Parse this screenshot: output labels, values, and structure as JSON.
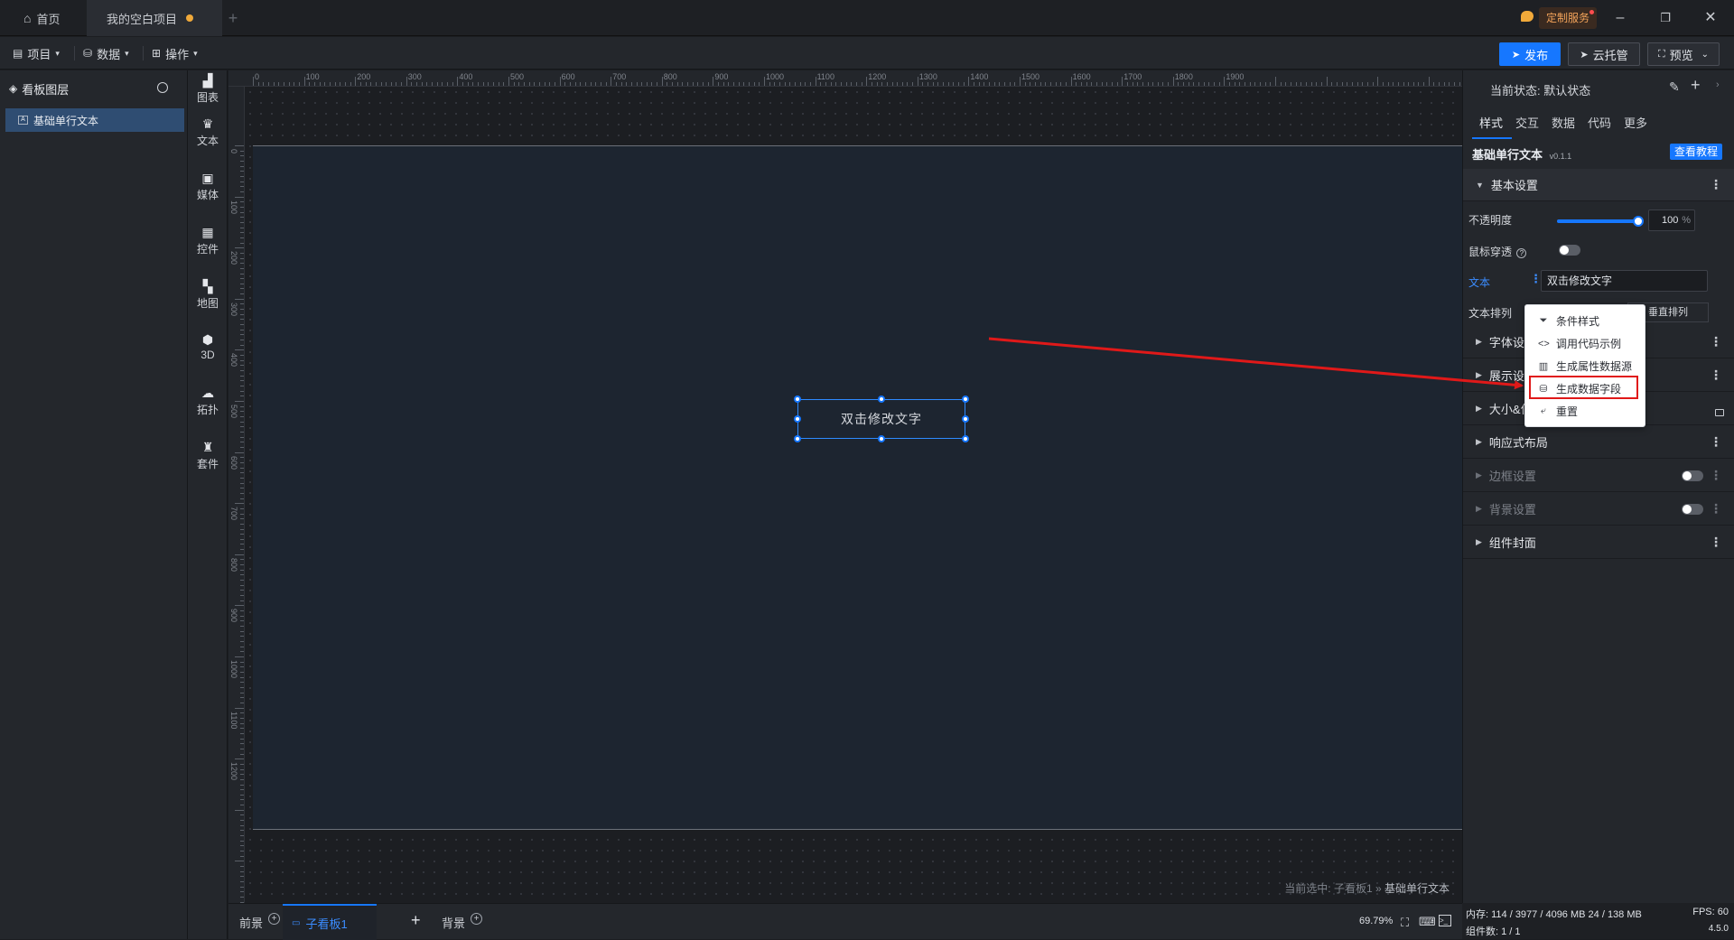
{
  "titlebar": {
    "home_tab": "首页",
    "project_tab": "我的空白项目",
    "custom_service": "定制服务"
  },
  "menubar": {
    "project": "项目",
    "data": "数据",
    "operation": "操作",
    "publish": "发布",
    "cloud_host": "云托管",
    "preview": "预览"
  },
  "layers": {
    "title": "看板图层",
    "items": [
      {
        "label": "基础单行文本"
      }
    ]
  },
  "components": [
    {
      "label": "图表",
      "icon": "chart-icon"
    },
    {
      "label": "文本",
      "icon": "text-crown-icon"
    },
    {
      "label": "媒体",
      "icon": "media-icon"
    },
    {
      "label": "控件",
      "icon": "widget-icon"
    },
    {
      "label": "地图",
      "icon": "map-icon"
    },
    {
      "label": "3D",
      "icon": "cube-icon"
    },
    {
      "label": "拓扑",
      "icon": "topology-icon"
    },
    {
      "label": "套件",
      "icon": "suite-icon"
    }
  ],
  "ruler": {
    "h_ticks": [
      "0",
      "100",
      "200",
      "300",
      "400",
      "500",
      "600",
      "700",
      "800",
      "900",
      "1000",
      "1100",
      "1200",
      "1300",
      "1400",
      "1500",
      "1600",
      "1700",
      "1800",
      "1900"
    ],
    "v_ticks": [
      "0",
      "100",
      "200",
      "300",
      "400",
      "500",
      "600",
      "700",
      "800",
      "900",
      "1000",
      "1100",
      "1200"
    ]
  },
  "canvas": {
    "widget_text": "双击修改文字",
    "breadcrumb_prefix": "当前选中: 子看板1 » ",
    "breadcrumb_current": "基础单行文本"
  },
  "bottombar": {
    "foreground": "前景",
    "sub_board": "子看板1",
    "background": "背景",
    "zoom": "69.79%"
  },
  "props": {
    "state_label": "当前状态: 默认状态",
    "tabs": [
      "样式",
      "交互",
      "数据",
      "代码",
      "更多"
    ],
    "component_name": "基础单行文本",
    "version": "v0.1.1",
    "tutorial_button": "查看教程",
    "basic_settings": "基本设置",
    "opacity_label": "不透明度",
    "opacity_value": "100",
    "opacity_unit": "%",
    "opacity_fraction": 1.0,
    "mouse_through": "鼠标穿透",
    "text_label": "文本",
    "text_value": "双击修改文字",
    "text_arrangement": "文本排列",
    "vertical_arrangement": "垂直排列",
    "sections": [
      {
        "label": "字体设",
        "dim": false
      },
      {
        "label": "展示设",
        "dim": false
      },
      {
        "label": "大小&位",
        "dim": false
      },
      {
        "label": "响应式布局",
        "dim": false
      },
      {
        "label": "边框设置",
        "dim": true
      },
      {
        "label": "背景设置",
        "dim": true
      },
      {
        "label": "组件封面",
        "dim": false
      }
    ]
  },
  "context_menu": {
    "items": [
      {
        "label": "条件样式",
        "icon": "filter-icon"
      },
      {
        "label": "调用代码示例",
        "icon": "code-icon"
      },
      {
        "label": "生成属性数据源",
        "icon": "data-source-icon"
      },
      {
        "label": "生成数据字段",
        "icon": "database-icon",
        "highlighted": true
      },
      {
        "label": "重置",
        "icon": "reset-icon"
      }
    ]
  },
  "status": {
    "memory": "内存: 114 / 3977 / 4096 MB  24 / 138 MB",
    "fps": "FPS: 60",
    "components": "组件数: 1 / 1",
    "version": "4.5.0"
  },
  "colors": {
    "accent": "#1677ff",
    "annotation_red": "#e01919",
    "unsaved_dot": "#f0a93a"
  }
}
